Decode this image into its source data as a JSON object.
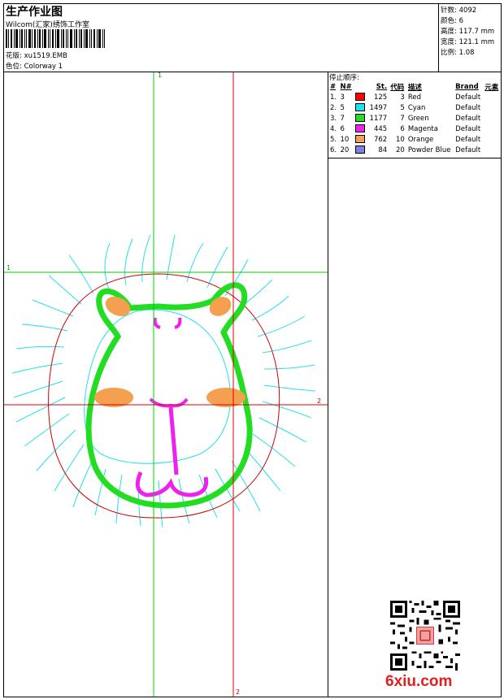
{
  "header": {
    "title": "生产作业图",
    "company": "Wilcom(汇家)绣饰工作室",
    "design_label": "花版:",
    "design_file": "xu1519.EMB",
    "colorway_label": "色位:",
    "colorway": "Colorway 1"
  },
  "specs": [
    {
      "label": "针数:",
      "value": "4092"
    },
    {
      "label": "颜色:",
      "value": "6"
    },
    {
      "label": "高度:",
      "value": "117.7 mm"
    },
    {
      "label": "宽度:",
      "value": "121.1 mm"
    },
    {
      "label": "比例:",
      "value": "1.08"
    }
  ],
  "palette": {
    "title": "停止顺序:",
    "headers": [
      "#",
      "N#",
      "St.",
      "代码",
      "描述",
      "Brand",
      "元素"
    ],
    "rows": [
      {
        "num": "1.",
        "n": "3",
        "color": "#ff0000",
        "stitches": "125",
        "code": "3",
        "desc": "Red",
        "brand": "Default"
      },
      {
        "num": "2.",
        "n": "5",
        "color": "#22e0f0",
        "stitches": "1497",
        "code": "5",
        "desc": "Cyan",
        "brand": "Default"
      },
      {
        "num": "3.",
        "n": "7",
        "color": "#22dd22",
        "stitches": "1177",
        "code": "7",
        "desc": "Green",
        "brand": "Default"
      },
      {
        "num": "4.",
        "n": "6",
        "color": "#ee22ee",
        "stitches": "445",
        "code": "6",
        "desc": "Magenta",
        "brand": "Default"
      },
      {
        "num": "5.",
        "n": "10",
        "color": "#f4a050",
        "stitches": "762",
        "code": "10",
        "desc": "Orange",
        "brand": "Default"
      },
      {
        "num": "6.",
        "n": "20",
        "color": "#8080dd",
        "stitches": "84",
        "code": "20",
        "desc": "Powder Blue",
        "brand": "Default"
      }
    ]
  },
  "axes": {
    "green_label": "1",
    "red_label": "2"
  },
  "watermark": "6xiu.com",
  "colors": {
    "green_axis": "#00cc00",
    "red_axis": "#dd0000",
    "cyan": "#22e0f0",
    "green": "#22dd22",
    "magenta": "#ee22ee",
    "orange": "#f4a050",
    "red": "#cc0000"
  }
}
